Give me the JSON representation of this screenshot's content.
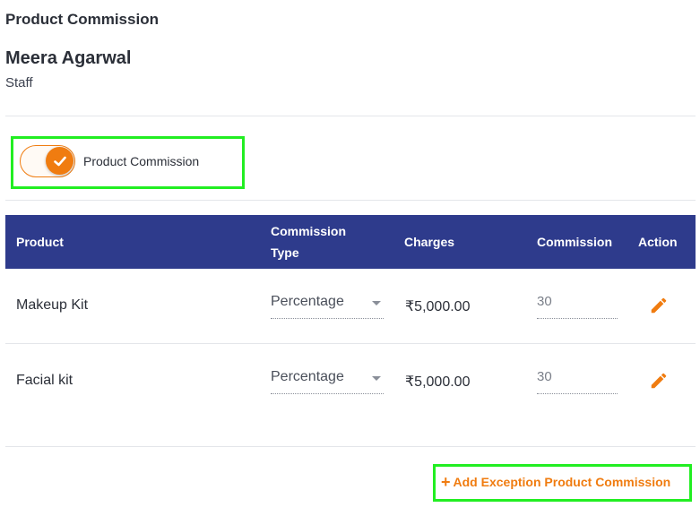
{
  "page": {
    "title": "Product Commission"
  },
  "staff": {
    "name": "Meera Agarwal",
    "role": "Staff"
  },
  "toggle": {
    "label": "Product Commission",
    "enabled": true,
    "accent_color": "#f07c10",
    "icon": "check-icon"
  },
  "table": {
    "header_color": "#2e3b8c",
    "columns": {
      "product": "Product",
      "commission_type_line1": "Commission",
      "commission_type_line2": "Type",
      "charges": "Charges",
      "commission": "Commission",
      "action": "Action"
    },
    "rows": [
      {
        "product": "Makeup Kit",
        "commission_type": "Percentage",
        "charges": "₹5,000.00",
        "commission": "30",
        "action_icon": "pencil-edit-icon"
      },
      {
        "product": "Facial kit",
        "commission_type": "Percentage",
        "charges": "₹5,000.00",
        "commission": "30",
        "action_icon": "pencil-edit-icon"
      }
    ]
  },
  "add_exception": {
    "label": "Add Exception Product Commission",
    "icon": "plus-icon"
  },
  "highlight_color": "#22ee22"
}
